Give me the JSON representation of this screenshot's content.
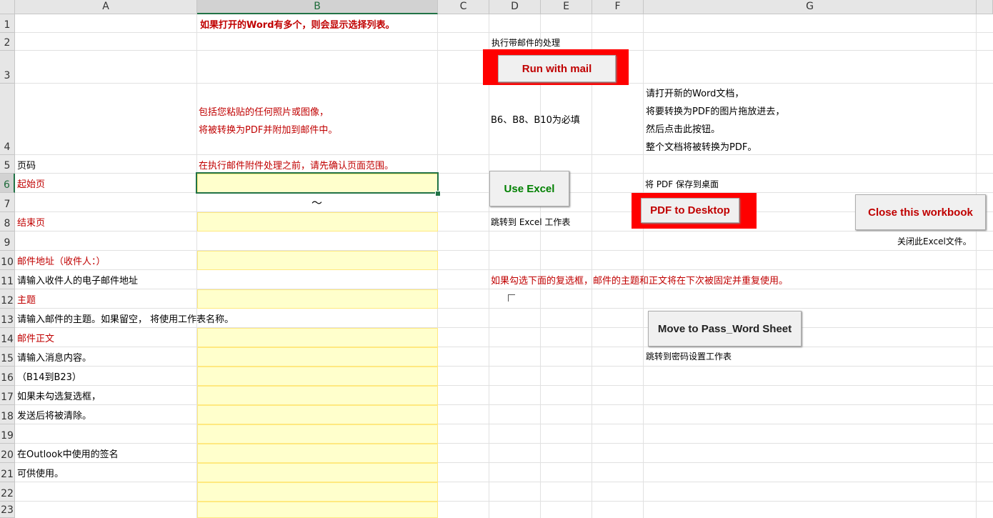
{
  "columns": [
    "A",
    "B",
    "C",
    "D",
    "E",
    "F",
    "G"
  ],
  "rows": [
    "1",
    "2",
    "3",
    "4",
    "5",
    "6",
    "7",
    "8",
    "9",
    "10",
    "11",
    "12",
    "13",
    "14",
    "15",
    "16",
    "17",
    "18",
    "19",
    "20",
    "21",
    "22",
    "23"
  ],
  "cells": {
    "B1": "如果打开的Word有多个，则会显示选择列表。",
    "D2": "执行带邮件的处理",
    "B4a": "包括您粘贴的任何照片或图像，",
    "B4b": "将被转换为PDF并附加到邮件中。",
    "D4": "B6、B8、B10为必填",
    "G4a": "请打开新的Word文档，",
    "G4b": "将要转换为PDF的图片拖放进去，",
    "G4c": "然后点击此按钮。",
    "G4d": "整个文档将被转换为PDF。",
    "A5": "页码",
    "B5": "在执行邮件附件处理之前，请先确认页面范围。",
    "A6": "起始页",
    "G6": "将 PDF 保存到桌面",
    "B7": "～",
    "A8": "结束页",
    "D8": "跳转到 Excel 工作表",
    "G9": "关闭此Excel文件。",
    "A10": "邮件地址（收件人：）",
    "A11": "请输入收件人的电子邮件地址",
    "D11": "如果勾选下面的复选框，邮件的主题和正文将在下次被固定并重复使用。",
    "A12": "主题",
    "A13": "请输入邮件的主题。如果留空， 将使用工作表名称。",
    "A14": "邮件正文",
    "A15": "请输入消息内容。",
    "A16": "（B14到B23）",
    "A17": "如果未勾选复选框，",
    "A18": "发送后将被清除。",
    "A20": "在Outlook中使用的签名",
    "A21": "可供使用。",
    "G13": "跳转到密码设置工作表"
  },
  "buttons": {
    "run_mail": "Run with mail",
    "use_excel": "Use Excel",
    "pdf_desktop": "PDF to Desktop",
    "close_workbook": "Close this workbook",
    "move_pass": "Move to Pass_Word Sheet"
  },
  "colors": {
    "red_text": "#c00000",
    "green_text": "#008000",
    "red_box": "#ff0000",
    "input_fill": "#ffffcc",
    "selection": "#217346"
  }
}
